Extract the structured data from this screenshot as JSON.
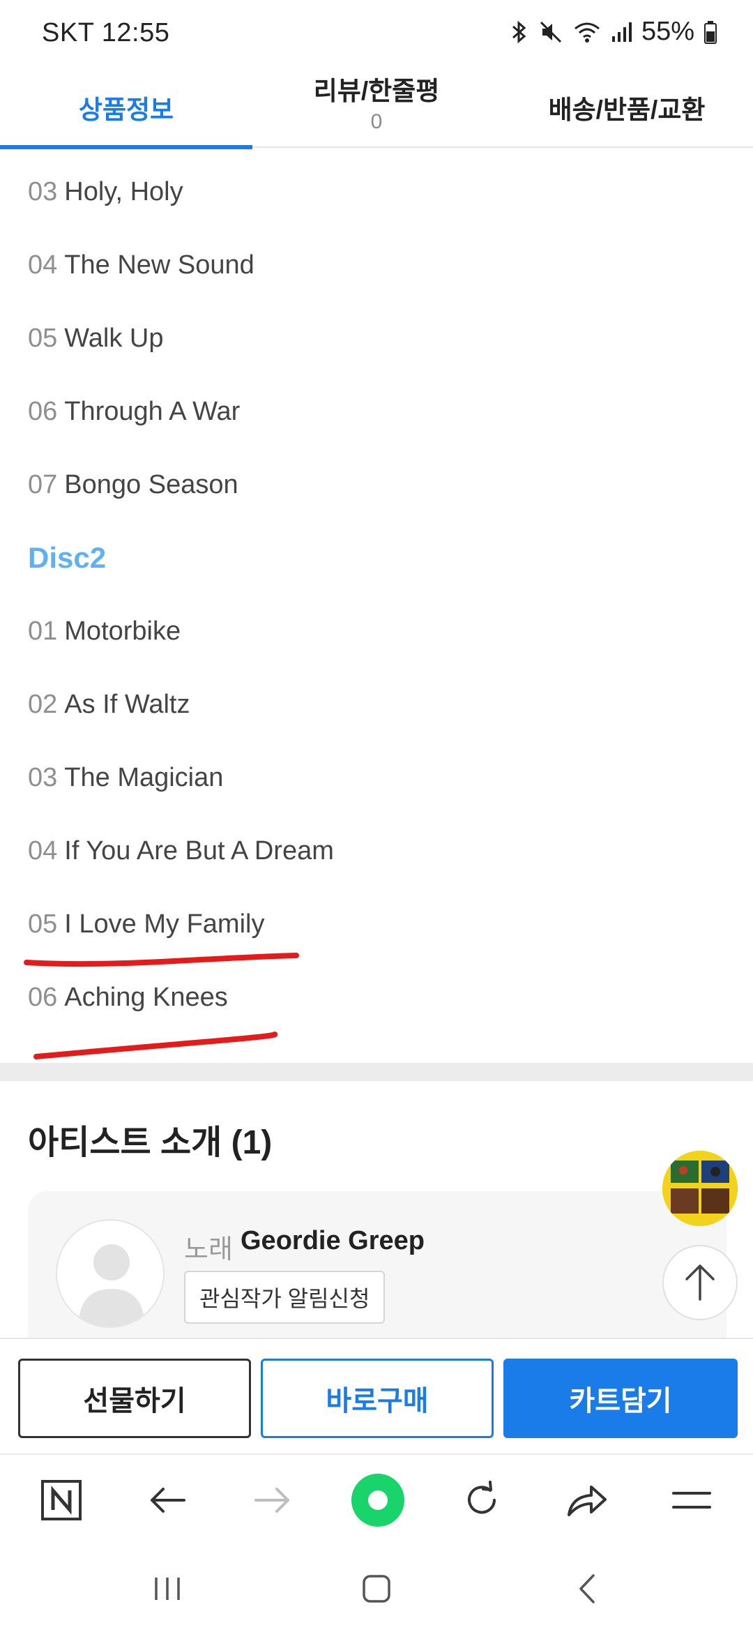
{
  "status_bar": {
    "carrier_time": "SKT 12:55",
    "battery": "55%",
    "icons": [
      "bluetooth-icon",
      "mute-icon",
      "wifi-icon",
      "signal-icon",
      "battery-icon"
    ]
  },
  "tabs": [
    {
      "label": "상품정보",
      "active": true
    },
    {
      "label": "리뷰/한줄평",
      "count": "0",
      "active": false
    },
    {
      "label": "배송/반품/교환",
      "active": false
    }
  ],
  "tracklist": {
    "disc1_tracks": [
      {
        "num": "03",
        "title": "Holy, Holy"
      },
      {
        "num": "04",
        "title": "The New Sound"
      },
      {
        "num": "05",
        "title": "Walk Up"
      },
      {
        "num": "06",
        "title": "Through A War"
      },
      {
        "num": "07",
        "title": "Bongo Season"
      }
    ],
    "disc2_label": "Disc2",
    "disc2_tracks": [
      {
        "num": "01",
        "title": "Motorbike"
      },
      {
        "num": "02",
        "title": "As If Waltz"
      },
      {
        "num": "03",
        "title": "The Magician"
      },
      {
        "num": "04",
        "title": "If You Are But A Dream"
      },
      {
        "num": "05",
        "title": "I Love My Family"
      },
      {
        "num": "06",
        "title": "Aching Knees"
      }
    ]
  },
  "artist_section": {
    "title": "아티스트 소개 (1)",
    "role": "노래",
    "name": "Geordie Greep",
    "follow_label": "관심작가 알림신청"
  },
  "purchase_bar": {
    "gift_label": "선물하기",
    "buy_now_label": "바로구매",
    "cart_label": "카트담기"
  },
  "browser_toolbar": {
    "icons": [
      "naver-home-icon",
      "back-arrow-icon",
      "forward-arrow-icon",
      "green-dot-icon",
      "refresh-icon",
      "share-icon",
      "menu-icon"
    ]
  },
  "nav_bar": {
    "icons": [
      "recent-apps-icon",
      "home-icon",
      "back-icon"
    ]
  },
  "colors": {
    "accent": "#1a7ce8",
    "disc_label": "#5fb1f2",
    "annotation_red": "#e41b1b",
    "green_button": "#19d36b"
  }
}
